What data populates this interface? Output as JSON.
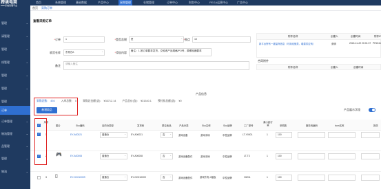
{
  "header": {
    "logo": "跨境电商",
    "logo_sub": "ERP系统管理平台",
    "nav": [
      {
        "label": "首页"
      },
      {
        "label": "系统管理"
      },
      {
        "label": "基础数据"
      },
      {
        "label": "产品中心"
      },
      {
        "label": "采购管理"
      },
      {
        "label": "仓储管理"
      },
      {
        "label": "订单中心"
      },
      {
        "label": "财务中心"
      },
      {
        "label": "PEGA运营中心"
      },
      {
        "label": "广告中心"
      }
    ]
  },
  "sidebar": {
    "items": [
      {
        "label": "管理"
      },
      {
        "label": "请管理"
      },
      {
        "label": "管理"
      },
      {
        "label": "线管理"
      },
      {
        "label": "管理"
      },
      {
        "label": "管理"
      },
      {
        "label": "管理"
      },
      {
        "label": "订单"
      },
      {
        "label": "订单管理"
      },
      {
        "label": "物流管理"
      },
      {
        "label": "品管理"
      },
      {
        "label": "管理"
      },
      {
        "label": "物流"
      }
    ]
  },
  "tabs": [
    {
      "label": "首页"
    },
    {
      "label": "采购订单"
    }
  ],
  "form": {
    "page_title": "查看采购订单",
    "fields": {
      "order_no": {
        "label": "订单",
        "value": "1"
      },
      "is_tax": {
        "label": "是否含税",
        "value": "是"
      },
      "tax_point": {
        "label": "税点",
        "value": "10"
      },
      "receiving_warehouse": {
        "label": "收货仓库",
        "value": "东莞仓A"
      },
      "extra_content": {
        "label": "添加内容",
        "value": "备注：1.按订单要求发货，交验收产品规格/PO号，原螺栓器要求"
      },
      "remark": {
        "label": "备注",
        "placeholder": "请输入备注"
      }
    }
  },
  "attachments": {
    "headers": [
      "附件名称",
      "创建人",
      "创建时间",
      "附件ID"
    ],
    "row": {
      "name": "新平台所有一键量商信息（可用经营类，增建供应商）",
      "creator": "张明",
      "created_at": "2024-11-22 20:01:37",
      "id": "PR24112223"
    }
  },
  "contracts": {
    "title": "合同附件",
    "headers": [
      "附件名称",
      "创建人",
      "创建时间"
    ]
  },
  "products": {
    "section_title": "产品信息",
    "stats": [
      {
        "label": "采购总数:",
        "value": "494"
      },
      {
        "label": "入库总数:",
        "value": "0"
      },
      {
        "label": "采购总金额(含):",
        "value": "¥33712.14"
      },
      {
        "label": "产品总价(含):",
        "value": "¥31540.1"
      },
      {
        "label": "预付款总额(含):",
        "value": "¥0"
      }
    ],
    "add_button": "新增商品",
    "display_toggle_label": "产品展示字段",
    "headers": [
      "序号",
      "图片",
      "Sku编码",
      "目的仓类型",
      "发货码",
      "是否卖品",
      "产品分类",
      "Sku名称",
      "Sku品牌",
      "工厂型号",
      "最小起订量",
      "采购数",
      "服务商编码",
      "bom名称",
      "报关"
    ],
    "rows": [
      {
        "no": "1",
        "sku": "EY-A00021",
        "wh_type": "普通仓",
        "ship_code": "EY-A00021",
        "is_sale": "否",
        "category": "游戏设备",
        "sku_name": "游戏手柄",
        "brand": "中性品牌",
        "factory_model": "LT-Y0001",
        "moq": "1",
        "qty": "100"
      },
      {
        "no": "2",
        "sku": "EY-A00008",
        "wh_type": "普通仓",
        "ship_code": "EY-A00008",
        "is_sale": "否",
        "category": "游戏设备配件",
        "sku_name": "游戏手柄",
        "brand": "中性品牌",
        "factory_model": "LT-T3",
        "moq": "1",
        "qty": "100"
      },
      {
        "no": "3",
        "sku": "EY-GC010009",
        "wh_type": "普通仓",
        "ship_code": "EY-GC010009",
        "is_sale": "否",
        "category": "游戏设备配件",
        "sku_name": "游戏外壳-4摇板",
        "brand": "中性品牌",
        "factory_model": "V6211",
        "moq": "1",
        "qty": "100"
      }
    ]
  },
  "colors": {
    "accent": "#2f6fd1",
    "nav_bg": "#1f3a60",
    "highlight": "#e02424"
  }
}
